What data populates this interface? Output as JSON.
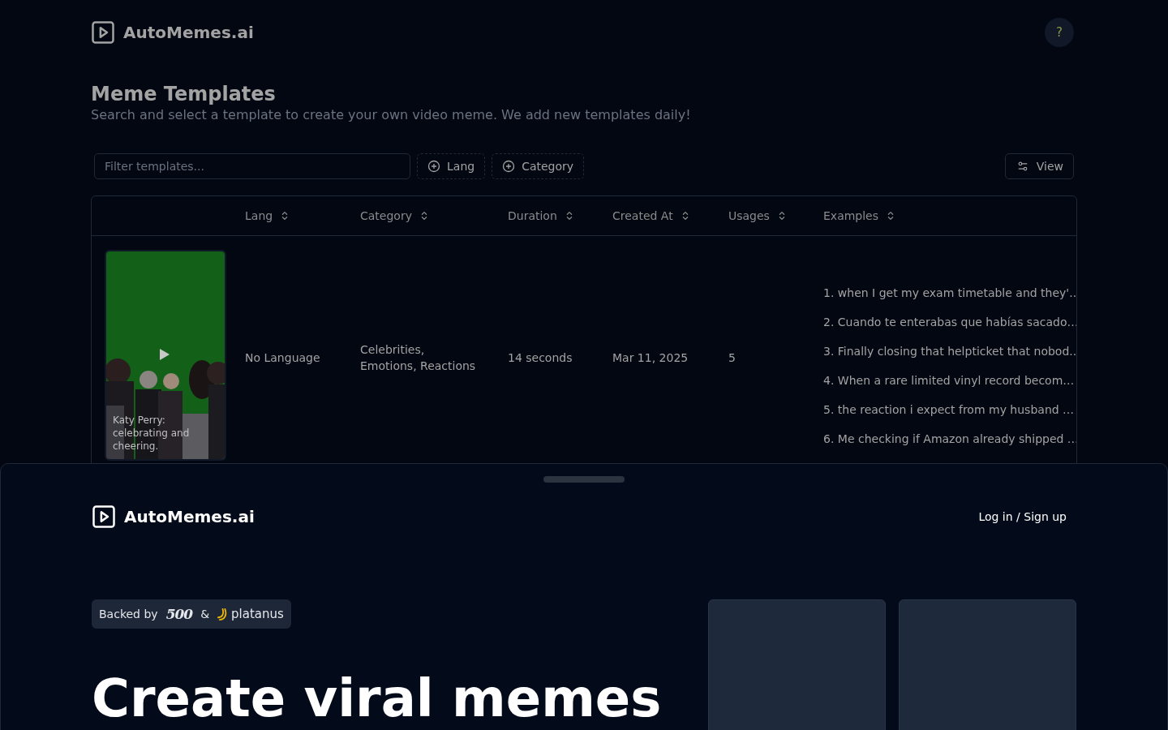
{
  "header": {
    "brand": "AutoMemes.ai",
    "help_button": "?"
  },
  "page": {
    "title": "Meme Templates",
    "subtitle": "Search and select a template to create your own video meme. We add new templates daily!"
  },
  "toolbar": {
    "filter": {
      "placeholder": "Filter templates..."
    },
    "facets": [
      "Lang",
      "Category"
    ],
    "view_button": "View"
  },
  "table": {
    "columns": [
      "Lang",
      "Category",
      "Duration",
      "Created At",
      "Usages",
      "Examples"
    ],
    "rows": [
      {
        "thumbnail": {
          "kind": "picture",
          "caption": "Katy Perry: celebrating and cheering."
        },
        "lang": "No Language",
        "category": "Celebrities, Emotions, Reactions",
        "duration": "14 seconds",
        "created_at": "Mar 11, 2025",
        "usages": "5",
        "examples": [
          "1. when I get my exam timetable and they'..",
          "2. Cuando te enterabas que habías sacado…",
          "3. Finally closing that helpticket that nobod..",
          "4. When a rare limited vinyl record becom…",
          "5. the reaction i expect from my husband …",
          "6. Me checking if Amazon already shipped …"
        ]
      }
    ]
  },
  "sheet": {
    "brand": "AutoMemes.ai",
    "login_link": "Log in / Sign up",
    "backed": {
      "label": "Backed by",
      "investor_1": "500",
      "separator": "&",
      "investor_2": "platanus"
    },
    "hero_title": "Create viral memes",
    "cards": [
      {
        "kind": "placeholder"
      },
      {
        "kind": "placeholder"
      }
    ]
  }
}
